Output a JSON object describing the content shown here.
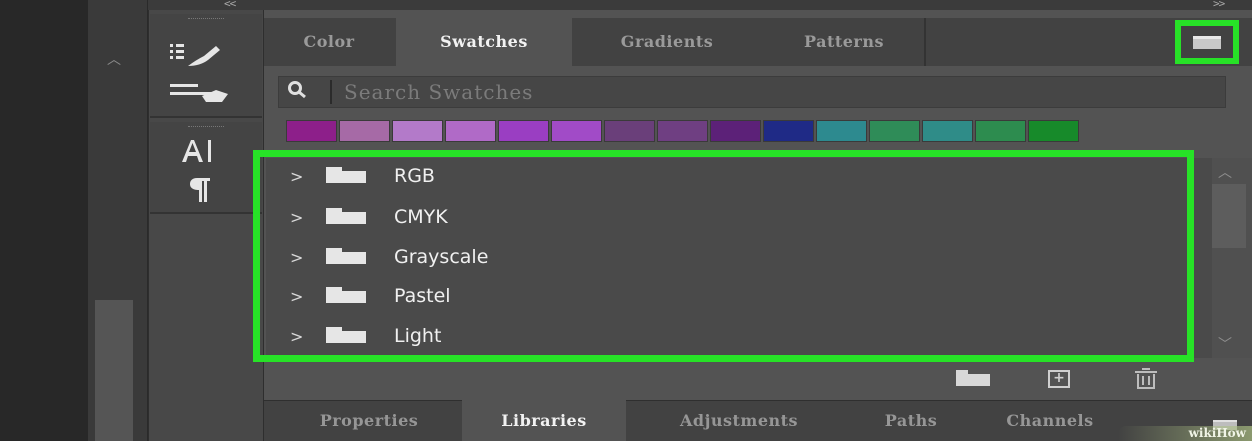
{
  "panel": {
    "collapse_left": "<<",
    "collapse_right": ">>",
    "tabs": [
      {
        "label": "Color",
        "active": false
      },
      {
        "label": "Swatches",
        "active": true
      },
      {
        "label": "Gradients",
        "active": false
      },
      {
        "label": "Patterns",
        "active": false
      }
    ],
    "menu_icon": "panel-menu-icon"
  },
  "search": {
    "placeholder": "Search Swatches",
    "value": ""
  },
  "swatches": [
    "#8d1f8a",
    "#a66aa6",
    "#b37ac9",
    "#b06ac7",
    "#9a3ec2",
    "#a14bc7",
    "#6a3f7a",
    "#6f3f82",
    "#5c2178",
    "#1f2a86",
    "#2d8a8f",
    "#2f8c58",
    "#2f8c88",
    "#2d8c4f",
    "#178a2a"
  ],
  "groups": [
    {
      "label": "RGB"
    },
    {
      "label": "CMYK"
    },
    {
      "label": "Grayscale"
    },
    {
      "label": "Pastel"
    },
    {
      "label": "Light"
    }
  ],
  "toolbar_icons": [
    "new-group-icon",
    "new-swatch-icon",
    "trash-icon"
  ],
  "bottom_tabs": [
    {
      "label": "Properties",
      "active": false
    },
    {
      "label": "Libraries",
      "active": true
    },
    {
      "label": "Adjustments",
      "active": false
    },
    {
      "label": "Paths",
      "active": false
    },
    {
      "label": "Channels",
      "active": false
    }
  ],
  "watermark": "wikiHow",
  "colors": {
    "highlight": "#27e227",
    "panel_bg": "#535353",
    "tabbar_bg": "#424242"
  }
}
